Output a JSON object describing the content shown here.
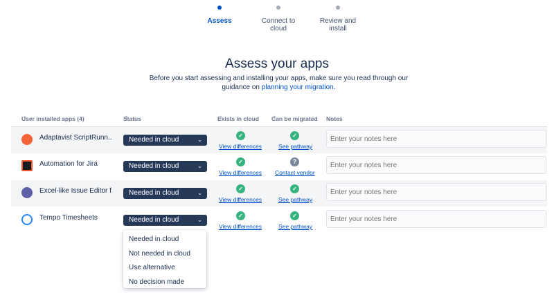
{
  "stepper": {
    "steps": [
      {
        "label": "Assess",
        "active": true
      },
      {
        "label": "Connect to\ncloud",
        "active": false
      },
      {
        "label": "Review and\ninstall",
        "active": false
      }
    ]
  },
  "page": {
    "title": "Assess your apps",
    "intro_text": "Before you start assessing and installing your apps, make sure you read through our guidance on ",
    "intro_link": "planning your migration",
    "intro_end": "."
  },
  "table": {
    "columns": {
      "apps": "User installed apps (4)",
      "status": "Status",
      "exists": "Exists in cloud",
      "migrate": "Can be migrated",
      "notes": "Notes"
    },
    "rows": [
      {
        "name": "Adaptavist ScriptRunn...",
        "icon_color": "#f4623a",
        "status": "Needed in cloud",
        "exists_icon": "check-icon",
        "exists_link": "View differences",
        "migrate_icon": "check-icon",
        "migrate_link": "See pathway",
        "notes_placeholder": "Enter your notes here"
      },
      {
        "name": "Automation for Jira",
        "icon_color": "#1a1a1a",
        "status": "Needed in cloud",
        "exists_icon": "check-icon",
        "exists_link": "View differences",
        "migrate_icon": "question-icon",
        "migrate_link": "Contact vendor",
        "notes_placeholder": "Enter your notes here"
      },
      {
        "name": "Excel-like Issue Editor f...",
        "icon_color": "#5e5fa8",
        "status": "Needed in cloud",
        "exists_icon": "check-icon",
        "exists_link": "View differences",
        "migrate_icon": "check-icon",
        "migrate_link": "See pathway",
        "notes_placeholder": "Enter your notes here"
      },
      {
        "name": "Tempo Timesheets",
        "icon_color": "#ffffff",
        "status": "Needed in cloud",
        "exists_icon": "check-icon",
        "exists_link": "View differences",
        "migrate_icon": "check-icon",
        "migrate_link": "See pathway",
        "notes_placeholder": "Enter your notes here"
      }
    ]
  },
  "dropdown": {
    "options": [
      "Needed in cloud",
      "Not needed in cloud",
      "Use alternative",
      "No decision made"
    ]
  },
  "colors": {
    "primary": "#0052cc",
    "select_bg": "#253858",
    "success": "#36b37e"
  }
}
